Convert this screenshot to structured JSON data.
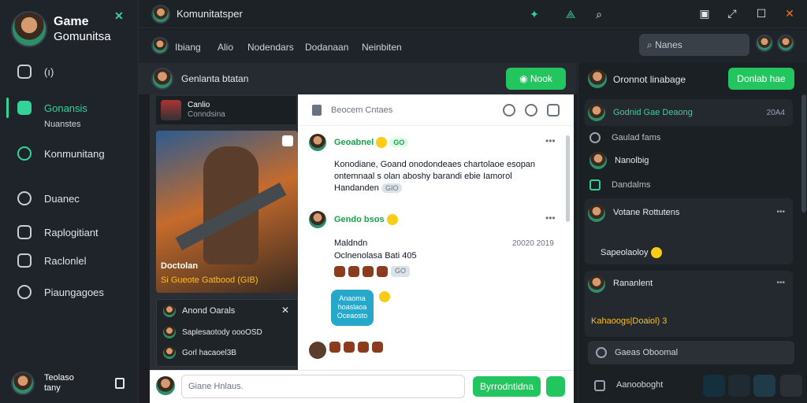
{
  "brand": {
    "title": "Game",
    "subtitle": "Gomunitsa"
  },
  "sidebar": {
    "items": [
      {
        "label": "(ı)"
      },
      {
        "label": "Gonansis"
      },
      {
        "label": "Konmunitang"
      },
      {
        "label": "Duanec"
      },
      {
        "label": "Raplogitiant"
      },
      {
        "label": "Raclonlel"
      },
      {
        "label": "Piaungagoes"
      }
    ],
    "sub_label": "Nuanstes",
    "user": {
      "name": "Teolaso",
      "status": "tany"
    }
  },
  "topbar": {
    "title": "Komunitatsper"
  },
  "tabs": {
    "items": [
      "Ibiang",
      "Alio",
      "Nodendars",
      "Dodanaan",
      "Neinbiten"
    ],
    "search_placeholder": "Nanes"
  },
  "channel": {
    "name": "Genlanta btatan",
    "button": "Nook"
  },
  "feed": {
    "card": {
      "title": "Canlio",
      "subtitle": "Conndsina"
    },
    "poster": {
      "title": "Doctolan",
      "caption": "Si Gueote Gatbood (GIB)"
    },
    "list": {
      "header": "Anond Oarals",
      "rows": [
        "Saplesaotody oooOSD",
        "Gorl hacaoel3B"
      ]
    }
  },
  "chat": {
    "header_label": "Beocem Cntaes",
    "messages": [
      {
        "user": "Geoabnel",
        "badge": "GO",
        "body": "Konodiane, Goand onodondeaes chartolaoe esopan ontemnaal s olan aboshy barandi ebie Iamorol Handanden",
        "pill": "GIO"
      },
      {
        "user": "Gendo bsos",
        "body_title": "Maldndn",
        "body": "Oclnenolasa Bati 405",
        "time": "20020 2019",
        "pill": "GO"
      }
    ],
    "bubble": "Anaoma hoaslaoa Oceaosto"
  },
  "composer": {
    "placeholder": "Giane Hnlaus.",
    "button": "Byrrodntidna"
  },
  "right": {
    "header": "Oronnot linabage",
    "button": "Donlab hae",
    "threads": [
      {
        "title": "Godnid Gae Deaong",
        "time": "20A4"
      },
      {
        "title": "Votane Rottutens",
        "body": "Sapeolaoloy"
      },
      {
        "title": "Rananlent",
        "body": "Kahaoogs|Doaiol) 3"
      }
    ],
    "rows": [
      "Gaulad fams",
      "Nanolbig",
      "Dandalms"
    ],
    "input": "Gaeas Oboomal",
    "footer": "Aanooboght"
  }
}
